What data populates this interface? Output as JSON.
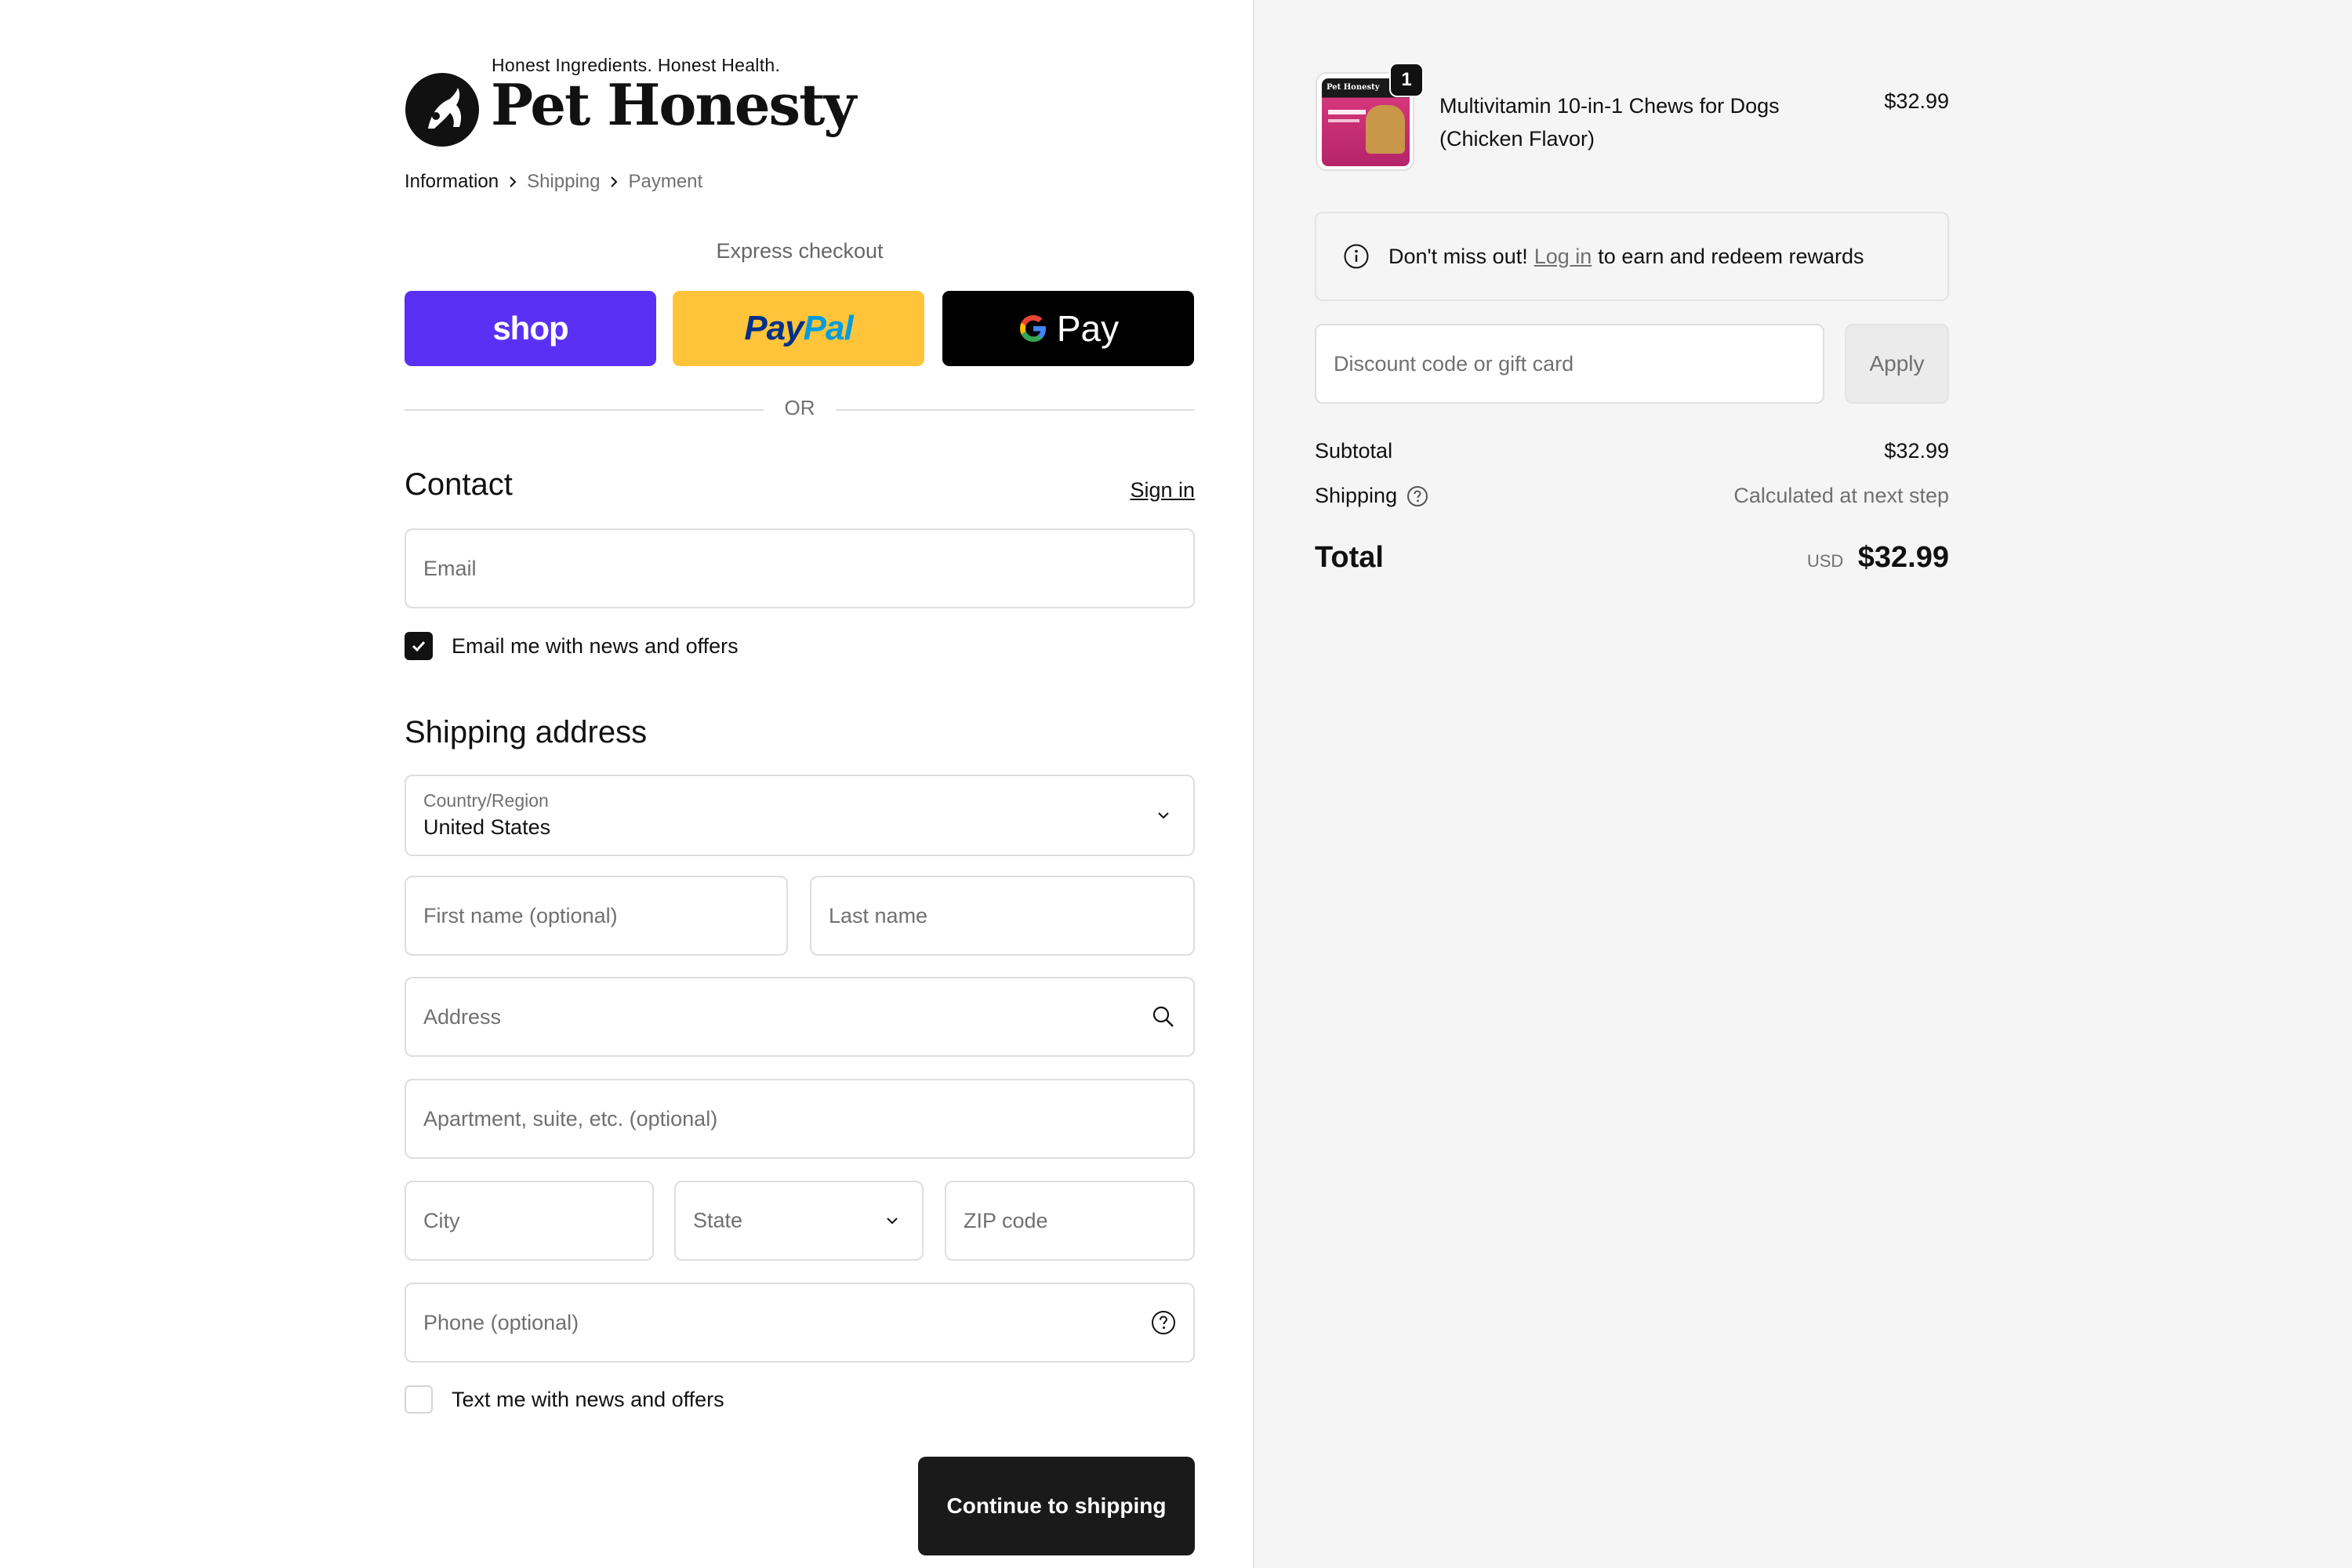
{
  "brand": {
    "tagline": "Honest Ingredients. Honest Health.",
    "name": "Pet Honesty"
  },
  "breadcrumb": {
    "steps": [
      "Information",
      "Shipping",
      "Payment"
    ]
  },
  "express": {
    "label": "Express checkout",
    "shop_label": "shop",
    "paypal_part1": "Pay",
    "paypal_part2": "Pal",
    "gpay_label": "Pay",
    "or_text": "OR"
  },
  "contact": {
    "title": "Contact",
    "sign_in": "Sign in",
    "email_placeholder": "Email",
    "news_checkbox": "Email me with news and offers",
    "news_checked": true
  },
  "shipping": {
    "title": "Shipping address",
    "country_label": "Country/Region",
    "country_value": "United States",
    "first_name_placeholder": "First name (optional)",
    "last_name_placeholder": "Last name",
    "address_placeholder": "Address",
    "apartment_placeholder": "Apartment, suite, etc. (optional)",
    "city_placeholder": "City",
    "state_placeholder": "State",
    "zip_placeholder": "ZIP code",
    "phone_placeholder": "Phone (optional)",
    "text_checkbox": "Text me with news and offers",
    "text_checked": false,
    "continue_label": "Continue to shipping"
  },
  "cart": {
    "item_name": "Multivitamin 10-in-1 Chews for Dogs (Chicken Flavor)",
    "item_price": "$32.99",
    "item_quantity": "1",
    "image_text": "Pet Honesty"
  },
  "rewards": {
    "prefix": "Don't miss out!",
    "link": "Log in",
    "suffix": "to earn and redeem rewards"
  },
  "discount": {
    "placeholder": "Discount code or gift card",
    "apply_label": "Apply"
  },
  "summary": {
    "subtotal_label": "Subtotal",
    "subtotal_value": "$32.99",
    "shipping_label": "Shipping",
    "shipping_value": "Calculated at next step",
    "total_label": "Total",
    "total_currency": "USD",
    "total_value": "$32.99"
  },
  "colors": {
    "shop": "#5a31f4",
    "paypal": "#ffc439",
    "gpay": "#000000",
    "primary_button": "#1a1a1a",
    "summary_bg": "#f5f5f5"
  },
  "icons": [
    "chevron-right-icon",
    "chevron-down-icon",
    "search-icon",
    "help-circle-icon",
    "info-icon",
    "checkmark-icon",
    "google-g-icon"
  ]
}
